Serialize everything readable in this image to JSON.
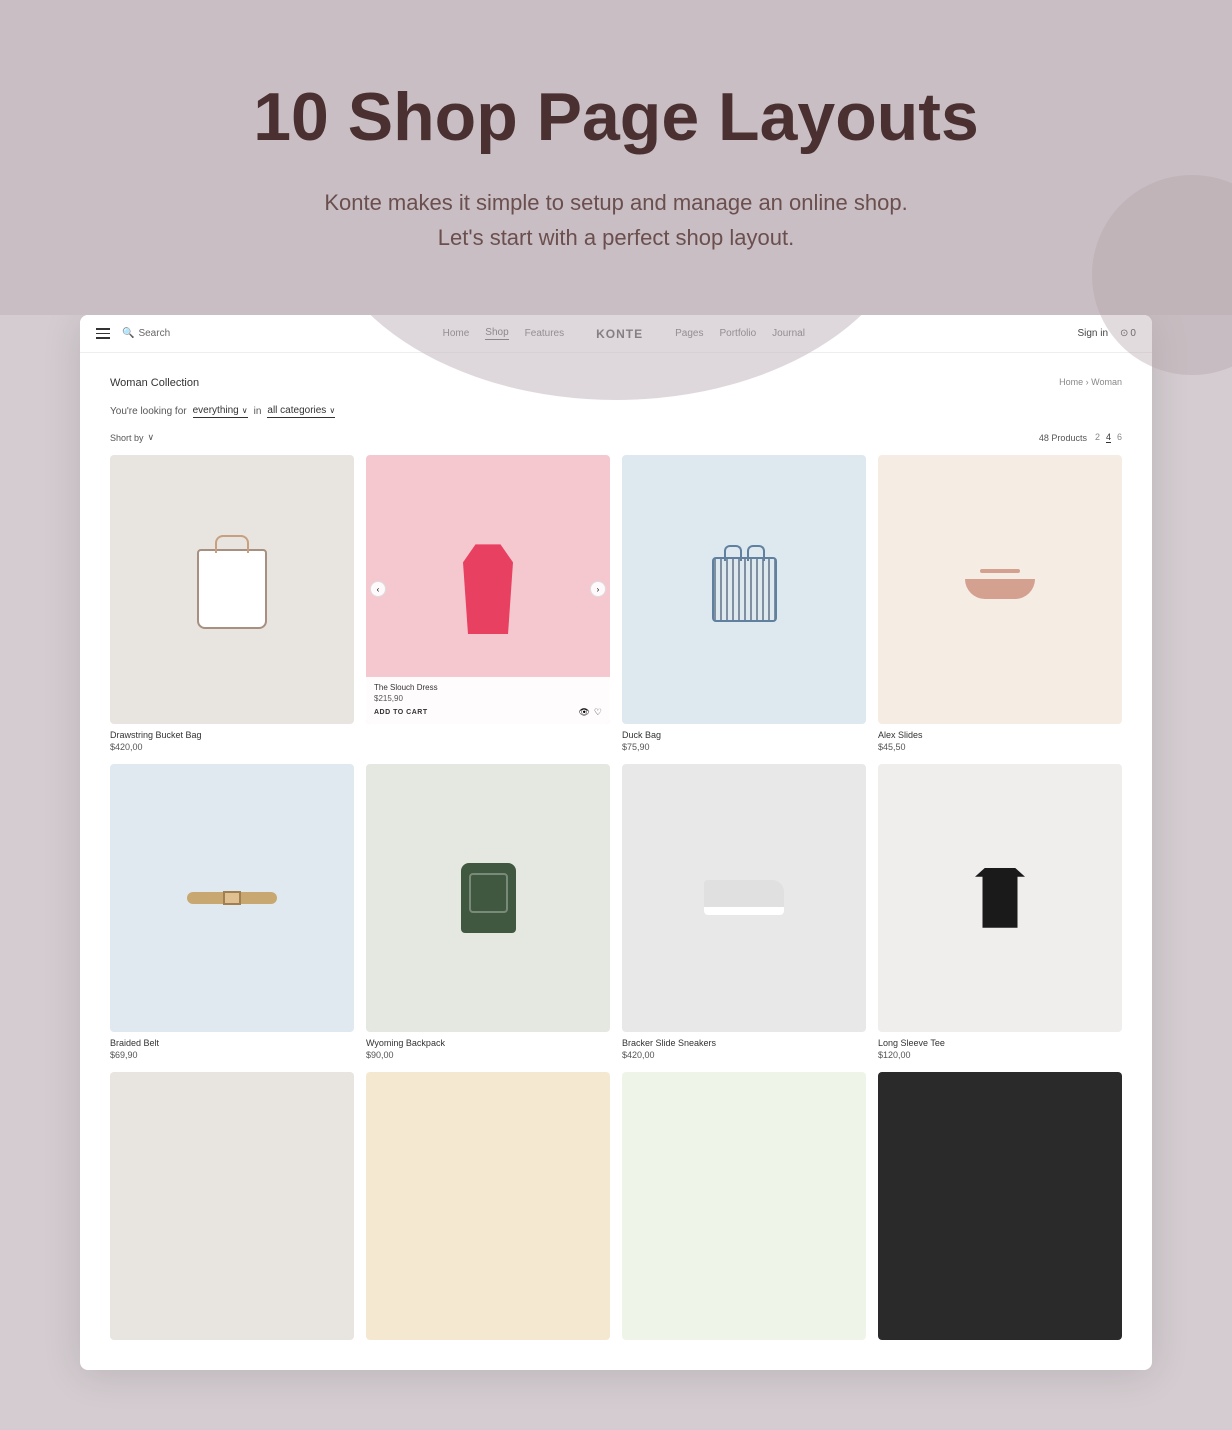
{
  "hero": {
    "title": "10 Shop Page Layouts",
    "subtitle_line1": "Konte makes it simple to setup and manage an online shop.",
    "subtitle_line2": "Let's start with a perfect shop layout."
  },
  "nav": {
    "search_placeholder": "Search",
    "links": [
      "Home",
      "Shop",
      "Features",
      "KONTE",
      "Pages",
      "Portfolio",
      "Journal"
    ],
    "active_link": "Shop",
    "sign_in": "Sign in",
    "cart_count": "0"
  },
  "shop": {
    "title": "Woman  Collection",
    "breadcrumb_home": "Home",
    "breadcrumb_current": "Woman",
    "filter_prefix": "You're looking for",
    "filter_keyword": "everything",
    "filter_in": "in",
    "filter_category": "all categories",
    "sort_label": "Short by",
    "products_count": "48 Products",
    "grid_options": [
      "2",
      "4",
      "6"
    ],
    "active_grid": "4"
  },
  "products": [
    {
      "id": 1,
      "name": "Drawstring Bucket Bag",
      "price": "$420,00",
      "img_class": "img-bag-1",
      "shape": "bag"
    },
    {
      "id": 2,
      "name": "The Slouch Dress",
      "price": "$215,90",
      "img_class": "img-dress",
      "shape": "dress",
      "has_overlay": true,
      "add_to_cart": "ADD TO CART"
    },
    {
      "id": 3,
      "name": "Duck Bag",
      "price": "$75,90",
      "img_class": "img-bag-2",
      "shape": "tote"
    },
    {
      "id": 4,
      "name": "Alex Slides",
      "price": "$45,50",
      "img_class": "img-sandal",
      "shape": "sandal"
    },
    {
      "id": 5,
      "name": "Braided Belt",
      "price": "$69,90",
      "img_class": "img-belt",
      "shape": "belt"
    },
    {
      "id": 6,
      "name": "Wyoming Backpack",
      "price": "$90,00",
      "img_class": "img-backpack",
      "shape": "backpack"
    },
    {
      "id": 7,
      "name": "Bracker Slide Sneakers",
      "price": "$420,00",
      "img_class": "img-sneakers",
      "shape": "sneaker"
    },
    {
      "id": 8,
      "name": "Long Sleeve Tee",
      "price": "$120,00",
      "img_class": "img-tee",
      "shape": "tee"
    },
    {
      "id": 9,
      "name": "",
      "price": "",
      "img_class": "img-row3a",
      "shape": "partial"
    },
    {
      "id": 10,
      "name": "",
      "price": "",
      "img_class": "img-row3b",
      "shape": "partial"
    },
    {
      "id": 11,
      "name": "",
      "price": "",
      "img_class": "img-row3c",
      "shape": "partial"
    },
    {
      "id": 12,
      "name": "",
      "price": "",
      "img_class": "img-row3d",
      "shape": "partial"
    }
  ],
  "icons": {
    "hamburger": "☰",
    "search": "🔍",
    "chevron_down": "∨",
    "cart": "⊙",
    "arrow_left": "‹",
    "arrow_right": "›",
    "eye": "👁",
    "heart": "♡"
  }
}
